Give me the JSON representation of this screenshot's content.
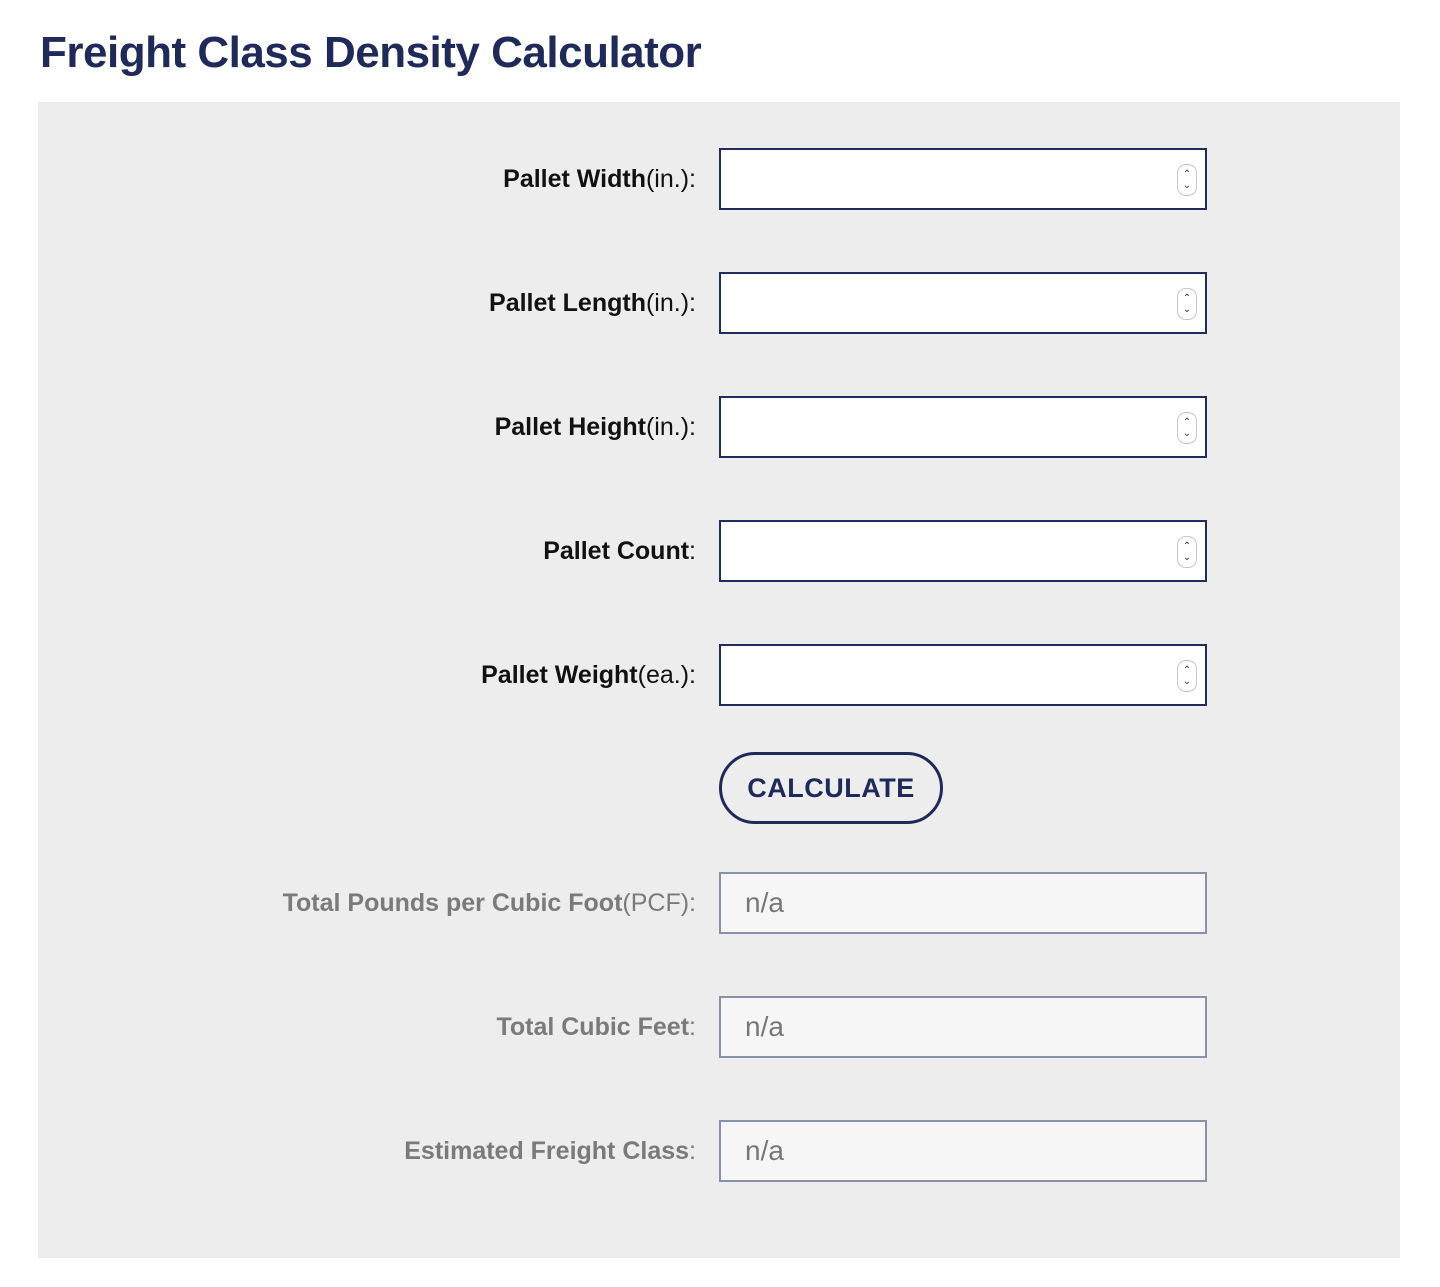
{
  "page": {
    "title": "Freight Class Density Calculator"
  },
  "inputs": [
    {
      "label": "Pallet Width",
      "unit": " (in.)",
      "suffix": ":",
      "value": ""
    },
    {
      "label": "Pallet Length",
      "unit": " (in.)",
      "suffix": ":",
      "value": ""
    },
    {
      "label": "Pallet Height",
      "unit": " (in.)",
      "suffix": ":",
      "value": ""
    },
    {
      "label": "Pallet Count",
      "unit": "",
      "suffix": ":",
      "value": ""
    },
    {
      "label": "Pallet Weight",
      "unit": " (ea.)",
      "suffix": ":",
      "value": ""
    }
  ],
  "button": {
    "calculate": "CALCULATE"
  },
  "outputs": [
    {
      "label": "Total Pounds per Cubic Foot",
      "unit": " (PCF)",
      "suffix": ":",
      "value": "n/a"
    },
    {
      "label": "Total Cubic Feet",
      "unit": "",
      "suffix": ":",
      "value": "n/a"
    },
    {
      "label": "Estimated Freight Class",
      "unit": "",
      "suffix": ":",
      "value": "n/a"
    }
  ],
  "icons": {
    "spinner_up": "▲",
    "spinner_down": "▼"
  },
  "colors": {
    "brand": "#1f2a5a",
    "panel": "#ededed",
    "muted_text": "#7a7a7a"
  }
}
